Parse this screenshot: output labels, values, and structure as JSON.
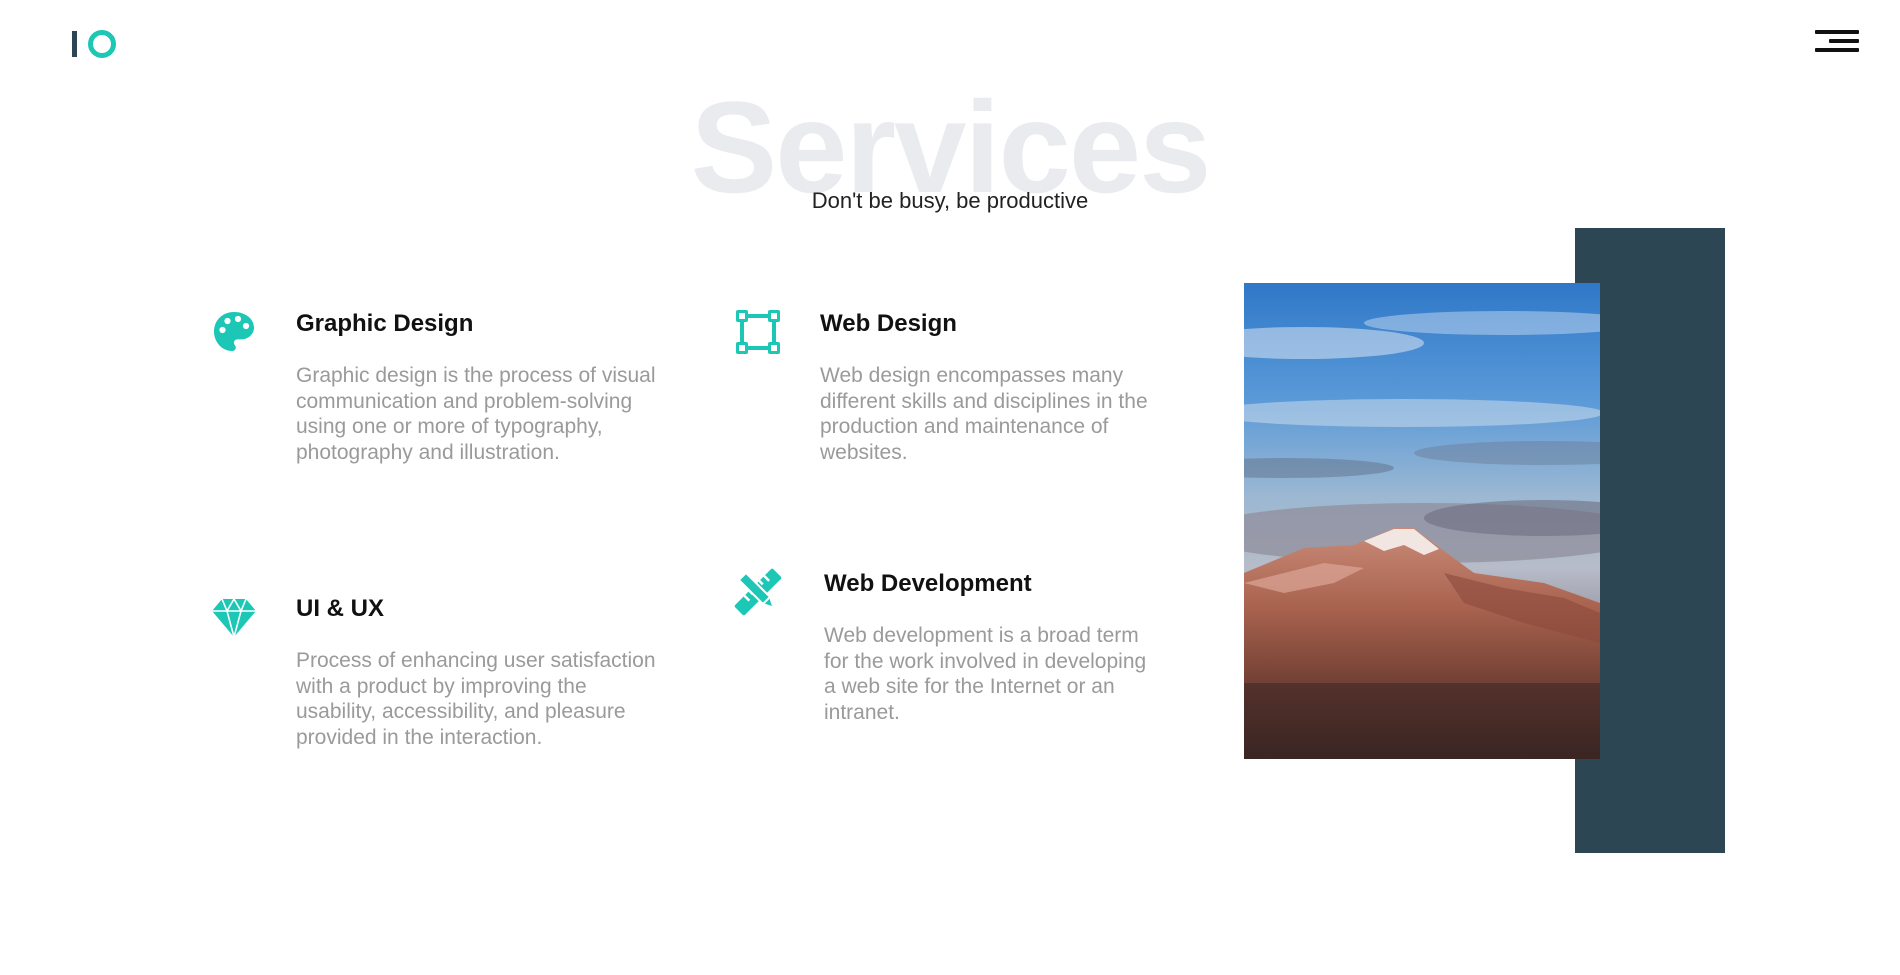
{
  "header": {
    "logo_icon": "io-logo",
    "menu_icon": "hamburger-menu-icon"
  },
  "section": {
    "title": "Services",
    "subtitle": "Don't be busy, be productive"
  },
  "services": [
    {
      "icon": "palette-icon",
      "title": "Graphic Design",
      "description": "Graphic design is the process of visual communication and problem-solving using one or more of typography, photography and illustration."
    },
    {
      "icon": "vector-square-icon",
      "title": "Web Design",
      "description": "Web design encompasses many different skills and disciplines in the production and maintenance of websites."
    },
    {
      "icon": "diamond-icon",
      "title": "UI & UX",
      "description": "Process of enhancing user satisfaction with a product by improving the usability, accessibility, and pleasure provided in the interaction."
    },
    {
      "icon": "pencil-ruler-icon",
      "title": "Web Development",
      "description": "Web development is a broad term for the work involved in developing a web site for the Internet or an intranet."
    }
  ],
  "colors": {
    "accent": "#1cc7b5",
    "dark": "#2c4653",
    "text_muted": "#9a9a9a",
    "watermark": "#e9ebee"
  }
}
